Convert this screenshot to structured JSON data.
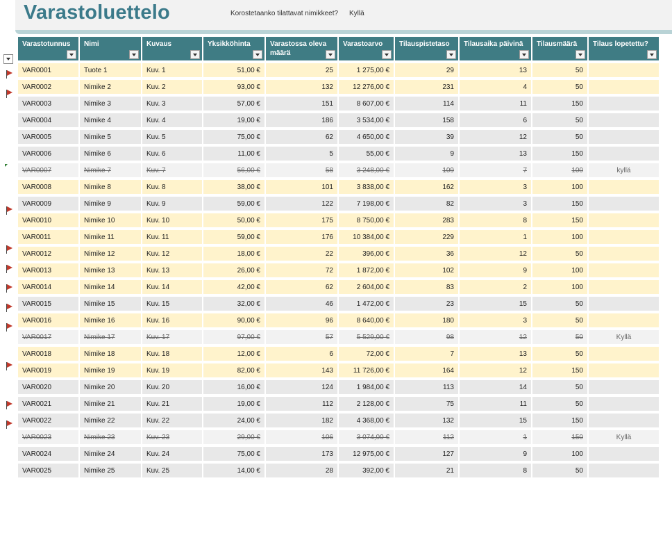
{
  "header": {
    "title": "Varastoluettelo",
    "highlight_prompt": "Korostetaanko tilattavat nimikkeet?",
    "highlight_answer": "Kyllä"
  },
  "columns": [
    "Varastotunnus",
    "Nimi",
    "Kuvaus",
    "Yksikköhinta",
    "Varastossa oleva määrä",
    "Varastoarvo",
    "Tilauspistetaso",
    "Tilausaika päivinä",
    "Tilausmäärä",
    "Tilaus lopetettu?"
  ],
  "colors": {
    "header_bg": "#3f7c84",
    "title": "#3b7a8a",
    "highlight_row": "#fff3cc",
    "normal_row": "#e8e8e8",
    "flag": "#c0392b"
  },
  "rows": [
    {
      "id": "VAR0001",
      "name": "Tuote 1",
      "desc": "Kuv. 1",
      "price": "51,00 €",
      "qty": "25",
      "value": "1 275,00 €",
      "reorder": "29",
      "days": "13",
      "order_qty": "50",
      "discontinued": "",
      "flagged": true,
      "status": "hl"
    },
    {
      "id": "VAR0002",
      "name": "Nimike 2",
      "desc": "Kuv. 2",
      "price": "93,00 €",
      "qty": "132",
      "value": "12 276,00 €",
      "reorder": "231",
      "days": "4",
      "order_qty": "50",
      "discontinued": "",
      "flagged": true,
      "status": "hl"
    },
    {
      "id": "VAR0003",
      "name": "Nimike 3",
      "desc": "Kuv. 3",
      "price": "57,00 €",
      "qty": "151",
      "value": "8 607,00 €",
      "reorder": "114",
      "days": "11",
      "order_qty": "150",
      "discontinued": "",
      "flagged": false,
      "status": "norm"
    },
    {
      "id": "VAR0004",
      "name": "Nimike 4",
      "desc": "Kuv. 4",
      "price": "19,00 €",
      "qty": "186",
      "value": "3 534,00 €",
      "reorder": "158",
      "days": "6",
      "order_qty": "50",
      "discontinued": "",
      "flagged": false,
      "status": "norm"
    },
    {
      "id": "VAR0005",
      "name": "Nimike 5",
      "desc": "Kuv. 5",
      "price": "75,00 €",
      "qty": "62",
      "value": "4 650,00 €",
      "reorder": "39",
      "days": "12",
      "order_qty": "50",
      "discontinued": "",
      "flagged": false,
      "status": "norm"
    },
    {
      "id": "VAR0006",
      "name": "Nimike 6",
      "desc": "Kuv. 6",
      "price": "11,00 €",
      "qty": "5",
      "value": "55,00 €",
      "reorder": "9",
      "days": "13",
      "order_qty": "150",
      "discontinued": "",
      "flagged": false,
      "status": "norm"
    },
    {
      "id": "VAR0007",
      "name": "Nimike 7",
      "desc": "Kuv. 7",
      "price": "56,00 €",
      "qty": "58",
      "value": "3 248,00 €",
      "reorder": "109",
      "days": "7",
      "order_qty": "100",
      "discontinued": "kyllä",
      "flagged": false,
      "status": "disc"
    },
    {
      "id": "VAR0008",
      "name": "Nimike 8",
      "desc": "Kuv. 8",
      "price": "38,00 €",
      "qty": "101",
      "value": "3 838,00 €",
      "reorder": "162",
      "days": "3",
      "order_qty": "100",
      "discontinued": "",
      "flagged": true,
      "status": "hl"
    },
    {
      "id": "VAR0009",
      "name": "Nimike 9",
      "desc": "Kuv. 9",
      "price": "59,00 €",
      "qty": "122",
      "value": "7 198,00 €",
      "reorder": "82",
      "days": "3",
      "order_qty": "150",
      "discontinued": "",
      "flagged": false,
      "status": "norm"
    },
    {
      "id": "VAR0010",
      "name": "Nimike 10",
      "desc": "Kuv. 10",
      "price": "50,00 €",
      "qty": "175",
      "value": "8 750,00 €",
      "reorder": "283",
      "days": "8",
      "order_qty": "150",
      "discontinued": "",
      "flagged": true,
      "status": "hl"
    },
    {
      "id": "VAR0011",
      "name": "Nimike 11",
      "desc": "Kuv. 11",
      "price": "59,00 €",
      "qty": "176",
      "value": "10 384,00 €",
      "reorder": "229",
      "days": "1",
      "order_qty": "100",
      "discontinued": "",
      "flagged": true,
      "status": "hl"
    },
    {
      "id": "VAR0012",
      "name": "Nimike 12",
      "desc": "Kuv. 12",
      "price": "18,00 €",
      "qty": "22",
      "value": "396,00 €",
      "reorder": "36",
      "days": "12",
      "order_qty": "50",
      "discontinued": "",
      "flagged": true,
      "status": "hl"
    },
    {
      "id": "VAR0013",
      "name": "Nimike 13",
      "desc": "Kuv. 13",
      "price": "26,00 €",
      "qty": "72",
      "value": "1 872,00 €",
      "reorder": "102",
      "days": "9",
      "order_qty": "100",
      "discontinued": "",
      "flagged": true,
      "status": "hl"
    },
    {
      "id": "VAR0014",
      "name": "Nimike 14",
      "desc": "Kuv. 14",
      "price": "42,00 €",
      "qty": "62",
      "value": "2 604,00 €",
      "reorder": "83",
      "days": "2",
      "order_qty": "100",
      "discontinued": "",
      "flagged": true,
      "status": "hl"
    },
    {
      "id": "VAR0015",
      "name": "Nimike 15",
      "desc": "Kuv. 15",
      "price": "32,00 €",
      "qty": "46",
      "value": "1 472,00 €",
      "reorder": "23",
      "days": "15",
      "order_qty": "50",
      "discontinued": "",
      "flagged": false,
      "status": "norm"
    },
    {
      "id": "VAR0016",
      "name": "Nimike 16",
      "desc": "Kuv. 16",
      "price": "90,00 €",
      "qty": "96",
      "value": "8 640,00 €",
      "reorder": "180",
      "days": "3",
      "order_qty": "50",
      "discontinued": "",
      "flagged": true,
      "status": "hl"
    },
    {
      "id": "VAR0017",
      "name": "Nimike 17",
      "desc": "Kuv. 17",
      "price": "97,00 €",
      "qty": "57",
      "value": "5 529,00 €",
      "reorder": "98",
      "days": "12",
      "order_qty": "50",
      "discontinued": "Kyllä",
      "flagged": false,
      "status": "disc"
    },
    {
      "id": "VAR0018",
      "name": "Nimike 18",
      "desc": "Kuv. 18",
      "price": "12,00 €",
      "qty": "6",
      "value": "72,00 €",
      "reorder": "7",
      "days": "13",
      "order_qty": "50",
      "discontinued": "",
      "flagged": true,
      "status": "hl"
    },
    {
      "id": "VAR0019",
      "name": "Nimike 19",
      "desc": "Kuv. 19",
      "price": "82,00 €",
      "qty": "143",
      "value": "11 726,00 €",
      "reorder": "164",
      "days": "12",
      "order_qty": "150",
      "discontinued": "",
      "flagged": true,
      "status": "hl"
    },
    {
      "id": "VAR0020",
      "name": "Nimike 20",
      "desc": "Kuv. 20",
      "price": "16,00 €",
      "qty": "124",
      "value": "1 984,00 €",
      "reorder": "113",
      "days": "14",
      "order_qty": "50",
      "discontinued": "",
      "flagged": false,
      "status": "norm"
    },
    {
      "id": "VAR0021",
      "name": "Nimike 21",
      "desc": "Kuv. 21",
      "price": "19,00 €",
      "qty": "112",
      "value": "2 128,00 €",
      "reorder": "75",
      "days": "11",
      "order_qty": "50",
      "discontinued": "",
      "flagged": false,
      "status": "norm"
    },
    {
      "id": "VAR0022",
      "name": "Nimike 22",
      "desc": "Kuv. 22",
      "price": "24,00 €",
      "qty": "182",
      "value": "4 368,00 €",
      "reorder": "132",
      "days": "15",
      "order_qty": "150",
      "discontinued": "",
      "flagged": false,
      "status": "norm"
    },
    {
      "id": "VAR0023",
      "name": "Nimike 23",
      "desc": "Kuv. 23",
      "price": "29,00 €",
      "qty": "106",
      "value": "3 074,00 €",
      "reorder": "112",
      "days": "1",
      "order_qty": "150",
      "discontinued": "Kyllä",
      "flagged": false,
      "status": "disc"
    },
    {
      "id": "VAR0024",
      "name": "Nimike 24",
      "desc": "Kuv. 24",
      "price": "75,00 €",
      "qty": "173",
      "value": "12 975,00 €",
      "reorder": "127",
      "days": "9",
      "order_qty": "100",
      "discontinued": "",
      "flagged": false,
      "status": "norm"
    },
    {
      "id": "VAR0025",
      "name": "Nimike 25",
      "desc": "Kuv. 25",
      "price": "14,00 €",
      "qty": "28",
      "value": "392,00 €",
      "reorder": "21",
      "days": "8",
      "order_qty": "50",
      "discontinued": "",
      "flagged": false,
      "status": "norm"
    }
  ]
}
